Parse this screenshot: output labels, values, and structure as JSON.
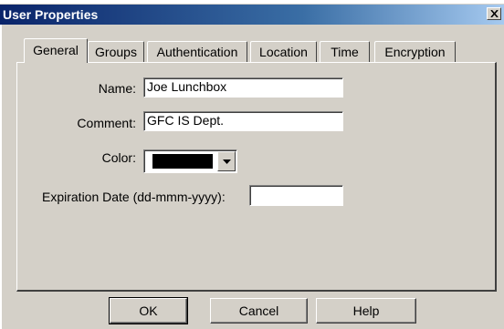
{
  "window": {
    "title": "User Properties",
    "close_icon": "close-icon"
  },
  "tabs": [
    {
      "label": "General",
      "active": true
    },
    {
      "label": "Groups",
      "active": false
    },
    {
      "label": "Authentication",
      "active": false
    },
    {
      "label": "Location",
      "active": false
    },
    {
      "label": "Time",
      "active": false
    },
    {
      "label": "Encryption",
      "active": false
    }
  ],
  "general": {
    "name_label": "Name:",
    "name_value": "Joe Lunchbox",
    "comment_label": "Comment:",
    "comment_value": "GFC IS Dept.",
    "color_label": "Color:",
    "color_value": "#000000",
    "expiration_label": "Expiration Date (dd-mmm-yyyy):",
    "expiration_value": ""
  },
  "buttons": {
    "ok": "OK",
    "cancel": "Cancel",
    "help": "Help"
  }
}
